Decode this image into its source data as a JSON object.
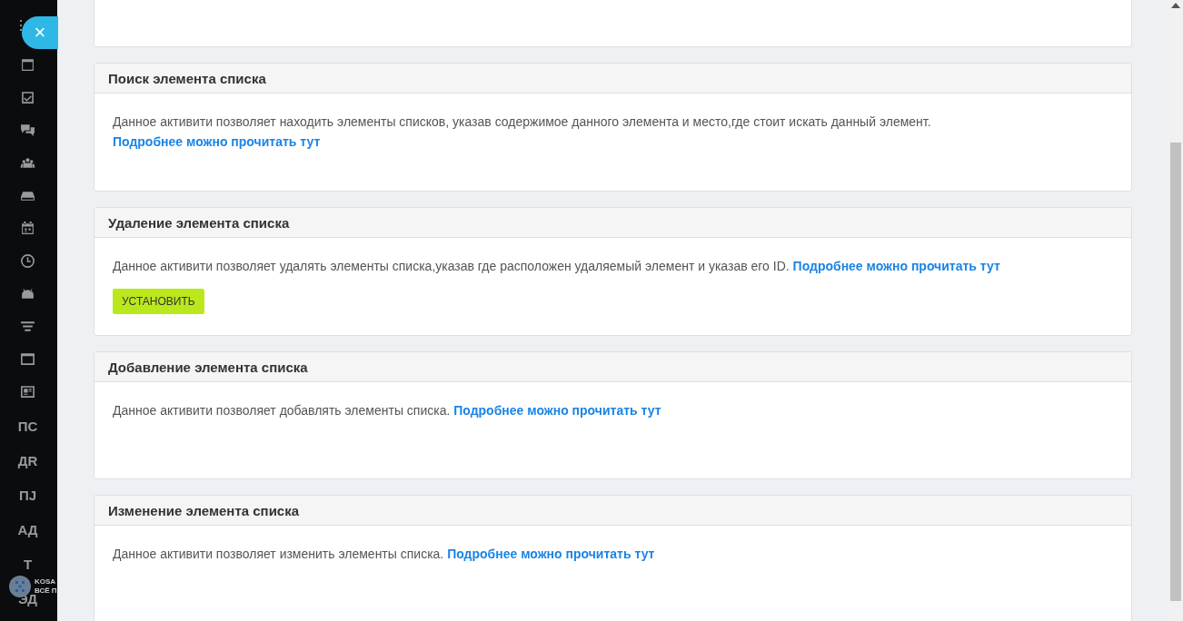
{
  "sidebar": {
    "close_label": "×",
    "text_items": [
      "ПС",
      "ДR",
      "ПJ",
      "АД",
      "Т",
      "ЭД"
    ],
    "logo": {
      "line_1": "KOSA",
      "line_2": "ВСЁ П"
    }
  },
  "sections": [
    {
      "title": "Поиск элемента списка",
      "text": "Данное активити позволяет находить элементы списков, указав содержимое данного элемента и место,где стоит искать данный элемент.",
      "link": "Подробнее можно прочитать тут"
    },
    {
      "title": "Удаление элемента списка",
      "text": "Данное активити позволяет удалять элементы списка,указав где расположен удаляемый элемент и указав его ID.",
      "link": "Подробнее можно прочитать тут",
      "button": "УСТАНОВИТЬ"
    },
    {
      "title": "Добавление элемента списка",
      "text": "Данное активити позволяет добавлять элементы списка.",
      "link": "Подробнее можно прочитать тут"
    },
    {
      "title": "Изменение элемента списка",
      "text": "Данное активити позволяет изменить элементы списка.",
      "link": "Подробнее можно прочитать тут"
    }
  ]
}
